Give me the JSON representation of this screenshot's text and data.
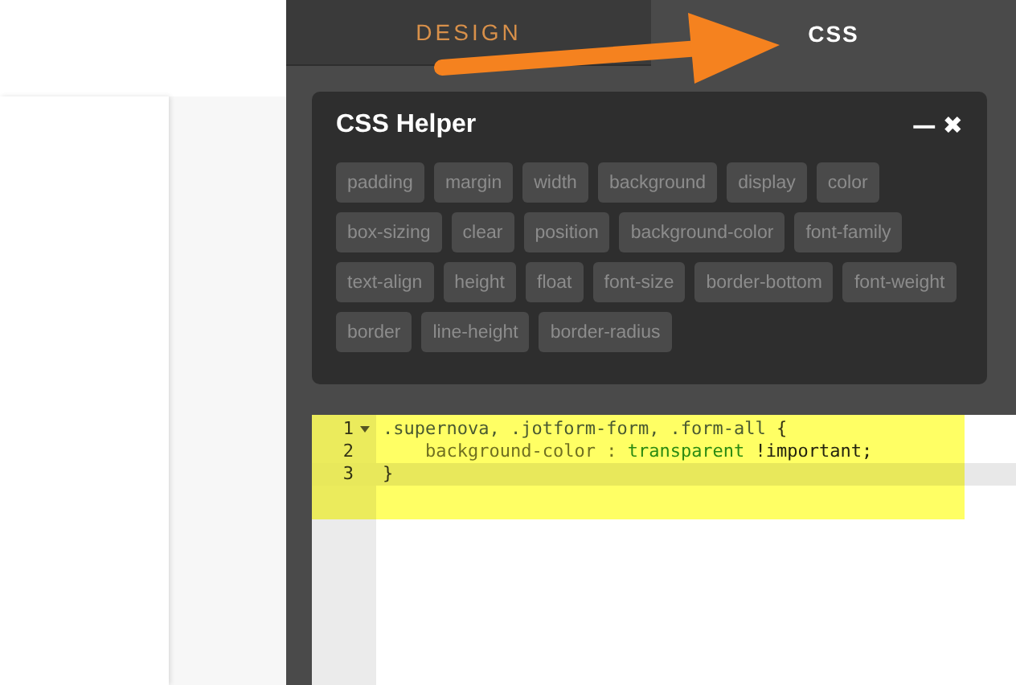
{
  "tabs": [
    {
      "label": "DESIGN",
      "selected": false
    },
    {
      "label": "CSS",
      "selected": true
    }
  ],
  "css_helper": {
    "title": "CSS Helper",
    "minimize_label": "—",
    "close_label": "✖",
    "properties": [
      "padding",
      "margin",
      "width",
      "background",
      "display",
      "color",
      "box-sizing",
      "clear",
      "position",
      "background-color",
      "font-family",
      "text-align",
      "height",
      "float",
      "font-size",
      "border-bottom",
      "font-weight",
      "border",
      "line-height",
      "border-radius"
    ]
  },
  "editor": {
    "highlighted": true,
    "lines": [
      {
        "number": "1",
        "foldable": true,
        "active": false,
        "tokens": [
          {
            "kind": "selector",
            "text": ".supernova, .jotform-form, .form-all "
          },
          {
            "kind": "punct",
            "text": "{"
          }
        ]
      },
      {
        "number": "2",
        "foldable": false,
        "active": false,
        "tokens": [
          {
            "kind": "property",
            "text": "    background-color : "
          },
          {
            "kind": "value",
            "text": "transparent"
          },
          {
            "kind": "important",
            "text": " !important;"
          }
        ]
      },
      {
        "number": "3",
        "foldable": false,
        "active": true,
        "tokens": [
          {
            "kind": "punct",
            "text": "}"
          }
        ]
      }
    ]
  }
}
